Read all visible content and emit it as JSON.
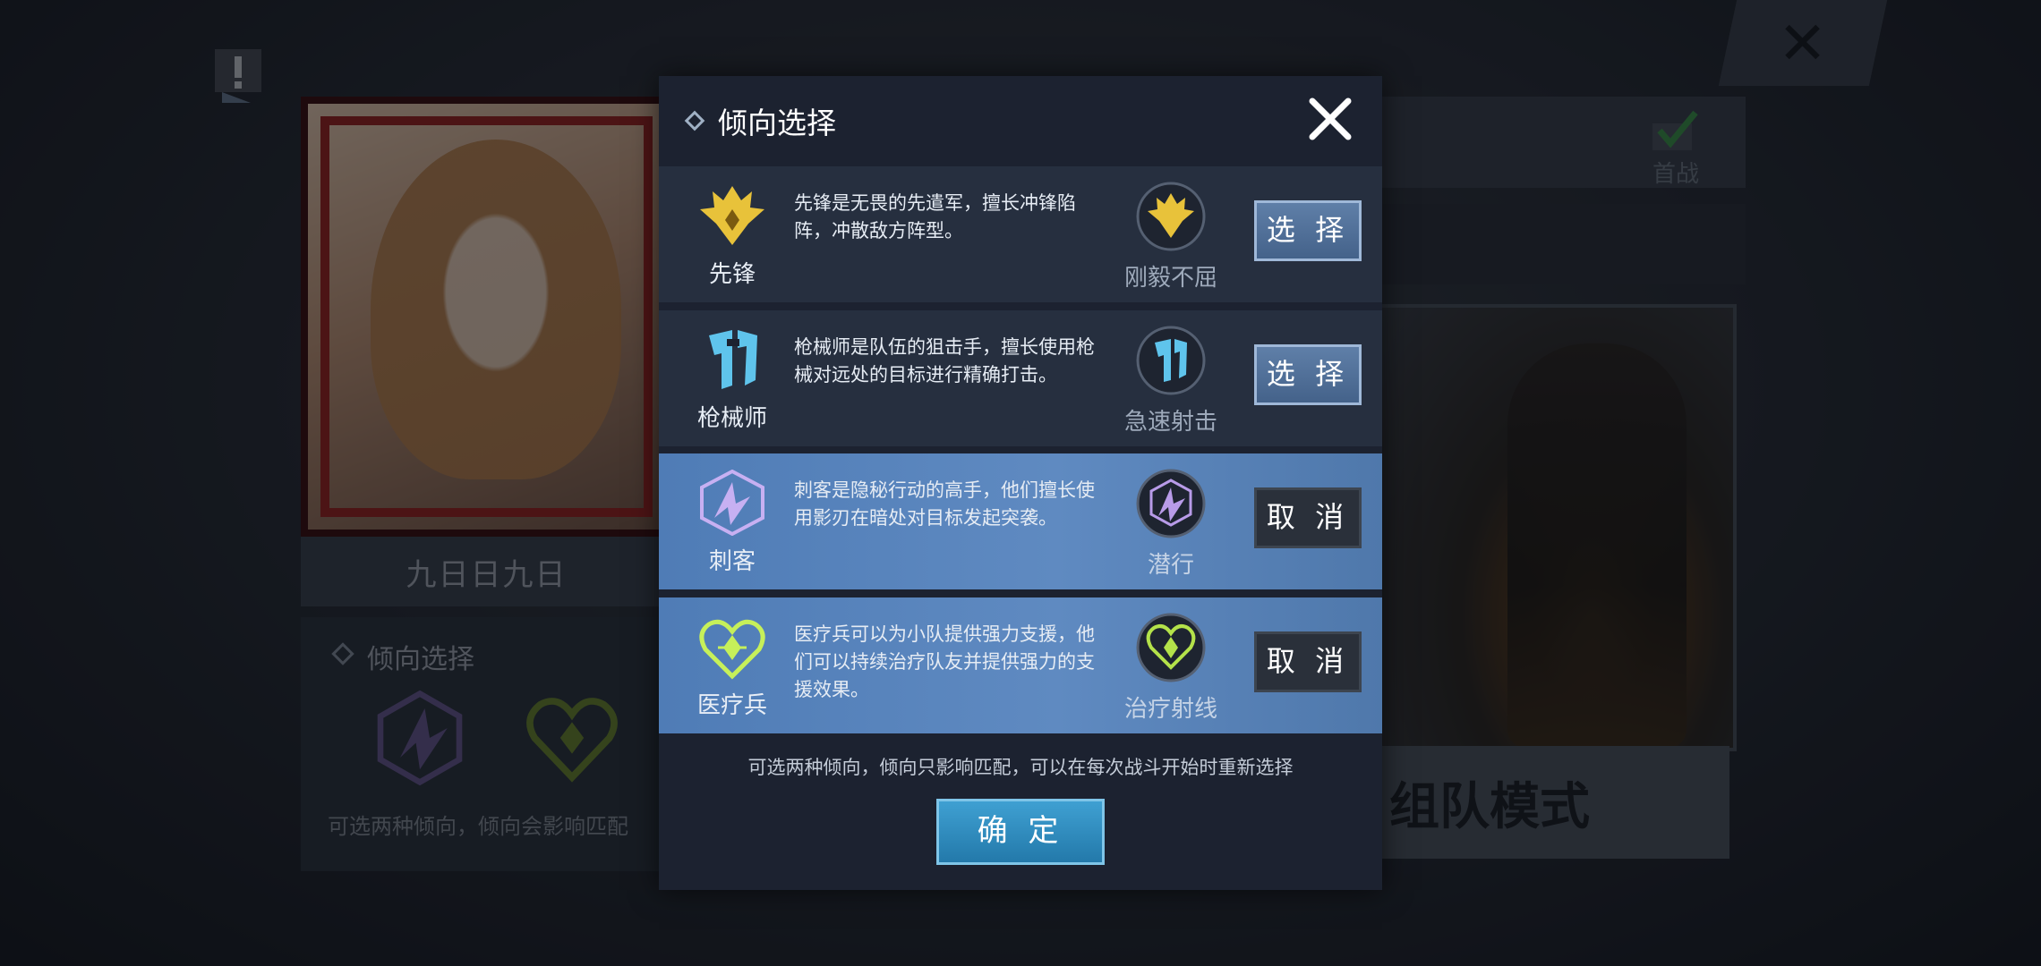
{
  "background": {
    "player_name": "九日日九日",
    "tendency_title": "倾向选择",
    "tendency_footer": "可选两种倾向，倾向会影响匹配",
    "first_win_label": "首战",
    "mode_label": "组队模式"
  },
  "modal": {
    "title": "倾向选择",
    "close_icon": "close-icon",
    "roles": [
      {
        "name": "先锋",
        "desc": "先锋是无畏的先遣军，擅长冲锋陷阵，冲散敌方阵型。",
        "skill": "刚毅不屈",
        "action": "选 择",
        "selected": false,
        "color": "#e8c23a"
      },
      {
        "name": "枪械师",
        "desc": "枪械师是队伍的狙击手，擅长使用枪械对远处的目标进行精确打击。",
        "skill": "急速射击",
        "action": "选 择",
        "selected": false,
        "color": "#5fc4ec"
      },
      {
        "name": "刺客",
        "desc": "刺客是隐秘行动的高手，他们擅长使用影刃在暗处对目标发起突袭。",
        "skill": "潜行",
        "action": "取 消",
        "selected": true,
        "color": "#b89be8"
      },
      {
        "name": "医疗兵",
        "desc": "医疗兵可以为小队提供强力支援，他们可以持续治疗队友并提供强力的支援效果。",
        "skill": "治疗射线",
        "action": "取 消",
        "selected": true,
        "color": "#b4e24a"
      }
    ],
    "hint": "可选两种倾向，倾向只影响匹配，可以在每次战斗开始时重新选择",
    "confirm_label": "确 定"
  }
}
